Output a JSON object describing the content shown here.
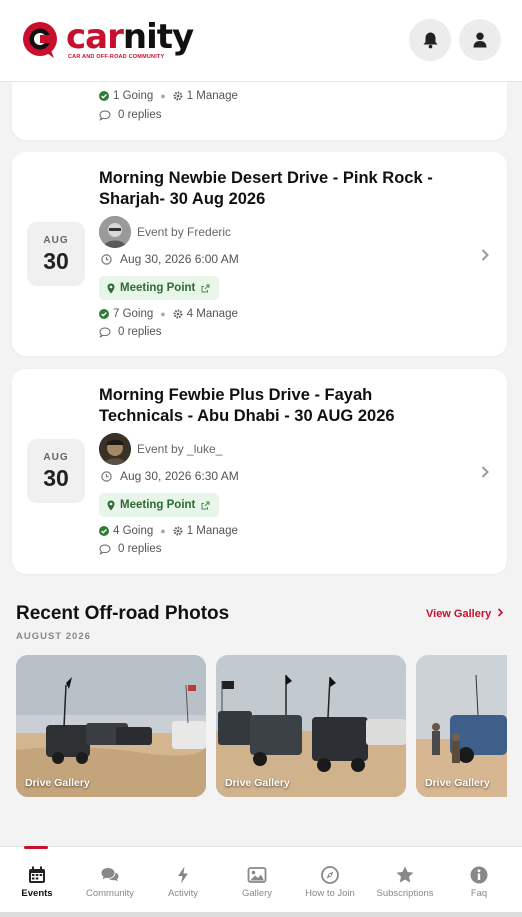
{
  "brand": {
    "name_red": "car",
    "name_dark": "nity",
    "tagline": "CAR AND OFF-ROAD COMMUNITY"
  },
  "header": {
    "notifications_icon": "bell-icon",
    "profile_icon": "user-icon"
  },
  "events": [
    {
      "going": "1 Going",
      "manage": "1 Manage",
      "replies": "0 replies"
    },
    {
      "month": "AUG",
      "day": "30",
      "title": "Morning Newbie Desert Drive - Pink Rock - Sharjah- 30 Aug 2026",
      "host": "Event by Frederic",
      "time": "Aug 30, 2026 6:00 AM",
      "meeting": "Meeting Point",
      "going": "7 Going",
      "manage": "4 Manage",
      "replies": "0 replies"
    },
    {
      "month": "AUG",
      "day": "30",
      "title": "Morning Fewbie Plus Drive - Fayah Technicals - Abu Dhabi - 30 AUG 2026",
      "host": "Event by _luke_",
      "time": "Aug 30, 2026 6:30 AM",
      "meeting": "Meeting Point",
      "going": "4 Going",
      "manage": "1 Manage",
      "replies": "0 replies"
    }
  ],
  "photos": {
    "title": "Recent Off-road Photos",
    "subtitle": "AUGUST 2026",
    "view_link": "View Gallery",
    "items": [
      {
        "label": "Drive Gallery"
      },
      {
        "label": "Drive Gallery"
      },
      {
        "label": "Drive Gallery"
      }
    ]
  },
  "nav": [
    {
      "label": "Events",
      "icon": "calendar-icon",
      "active": true
    },
    {
      "label": "Community",
      "icon": "comments-icon"
    },
    {
      "label": "Activity",
      "icon": "bolt-icon"
    },
    {
      "label": "Gallery",
      "icon": "image-icon"
    },
    {
      "label": "How to Join",
      "icon": "compass-icon"
    },
    {
      "label": "Subscriptions",
      "icon": "star-icon"
    },
    {
      "label": "Faq",
      "icon": "info-icon"
    }
  ],
  "colors": {
    "brand": "#c8102e",
    "meeting_bg": "#e8f5e9",
    "meeting_text": "#2e6b33"
  }
}
